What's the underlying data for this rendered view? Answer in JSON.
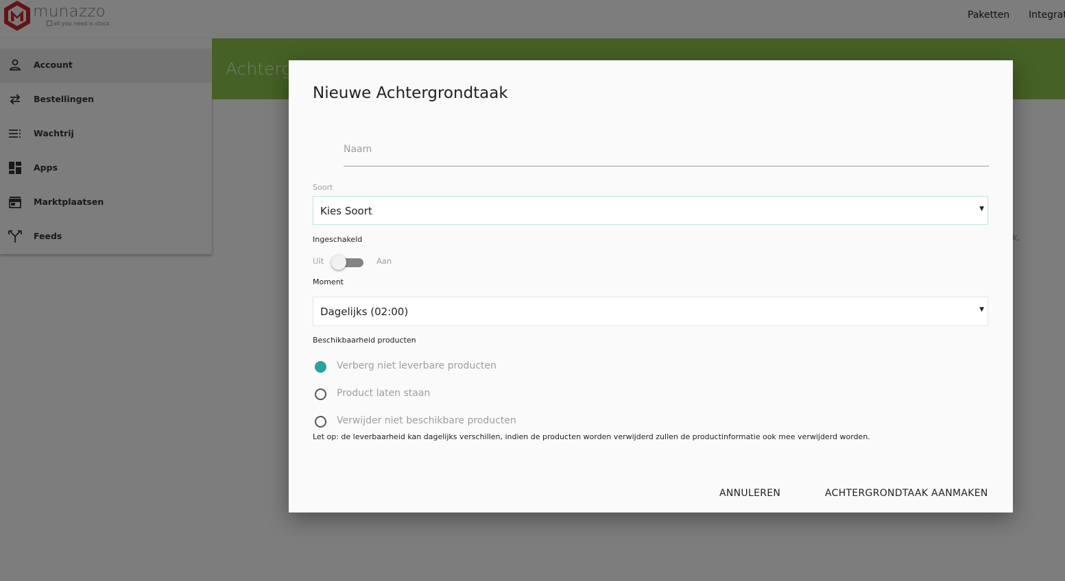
{
  "header": {
    "logo_word": "munazzo",
    "logo_tagline": "all you need is stock",
    "links": [
      "Paketten",
      "Integrati"
    ]
  },
  "sidebar": {
    "items": [
      {
        "label": "Account",
        "icon": "person-icon"
      },
      {
        "label": "Bestellingen",
        "icon": "swap-arrows-icon"
      },
      {
        "label": "Wachtrij",
        "icon": "queue-list-icon"
      },
      {
        "label": "Apps",
        "icon": "dashboard-grid-icon"
      },
      {
        "label": "Marktplaatsen",
        "icon": "store-icon"
      },
      {
        "label": "Feeds",
        "icon": "merge-arrows-icon"
      }
    ]
  },
  "banner": {
    "title": "Achtergrondtaken"
  },
  "background_fragment": "k.",
  "dialog": {
    "title": "Nieuwe Achtergrondtaak",
    "naam": {
      "placeholder": "Naam",
      "value": ""
    },
    "soort": {
      "label": "Soort",
      "value": "Kies Soort"
    },
    "ingeschakeld": {
      "label": "Ingeschakeld",
      "off_label": "Uit",
      "on_label": "Aan",
      "enabled": false
    },
    "moment": {
      "label": "Moment",
      "value": "Dagelijks (02:00)"
    },
    "beschikbaarheid": {
      "label": "Beschikbaarheid producten",
      "options": [
        {
          "label": "Verberg niet leverbare producten",
          "checked": true
        },
        {
          "label": "Product laten staan",
          "checked": false
        },
        {
          "label": "Verwijder niet beschikbare producten",
          "checked": false
        }
      ]
    },
    "note": "Let op: de leverbaarheid kan dagelijks verschillen, indien de producten worden verwijderd zullen de productinformatie ook mee verwijderd worden.",
    "cancel_label": "ANNULEREN",
    "submit_label": "ACHTERGRONDTAAK AANMAKEN"
  },
  "colors": {
    "brand_red": "#c62828",
    "banner_green": "#8bc34a",
    "accent_teal": "#26a69a"
  }
}
